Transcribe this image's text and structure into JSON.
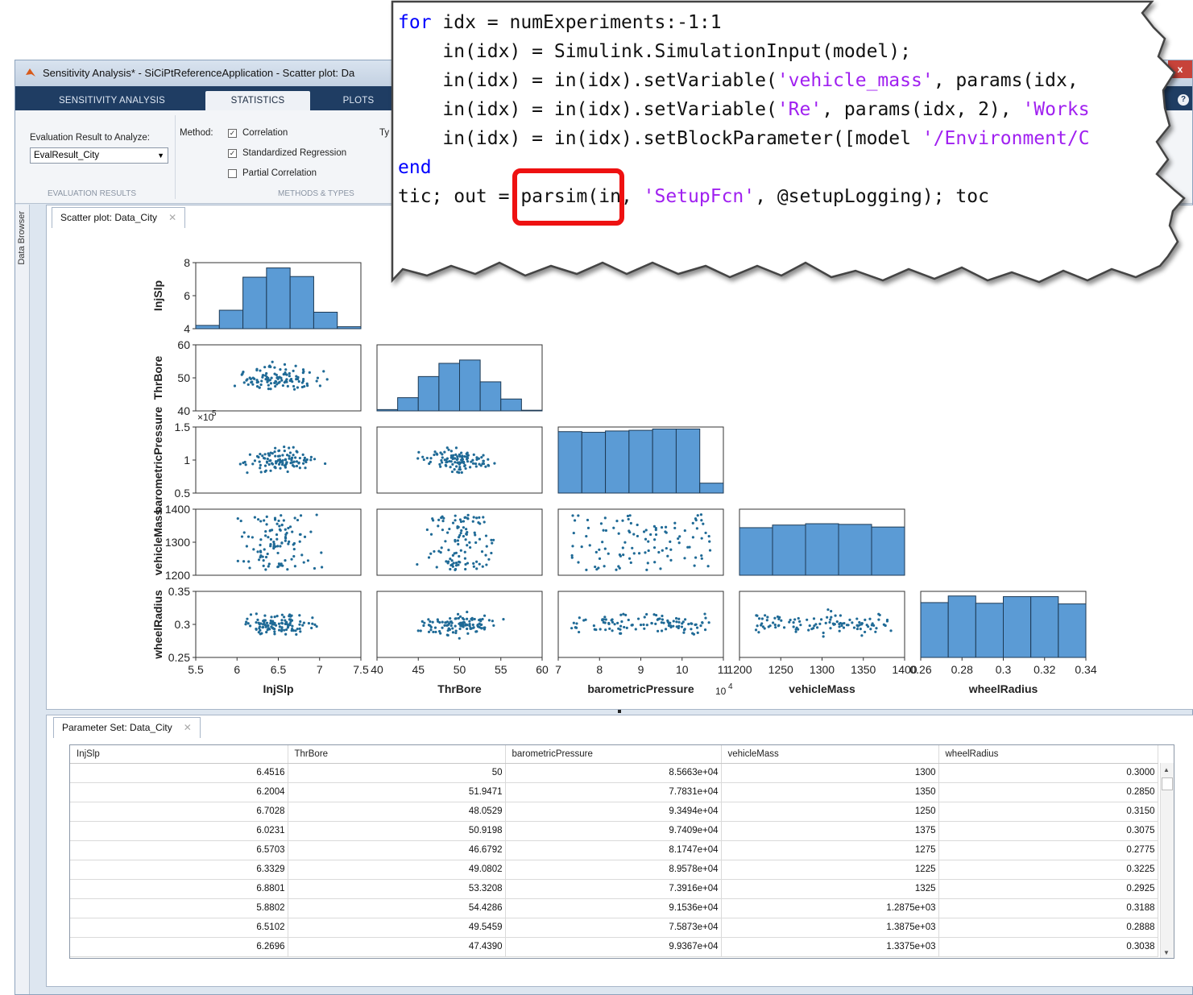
{
  "window": {
    "title": "Sensitivity Analysis* - SiCiPtReferenceApplication - Scatter plot: Da",
    "close_label": "x"
  },
  "ribbon": {
    "tabs": [
      "SENSITIVITY ANALYSIS",
      "STATISTICS",
      "PLOTS"
    ],
    "active_tab": "STATISTICS",
    "help_label": "?",
    "eval_label": "Evaluation Result to Analyze:",
    "eval_value": "EvalResult_City",
    "method_label": "Method:",
    "methods": [
      {
        "label": "Correlation",
        "checked": true
      },
      {
        "label": "Standardized Regression",
        "checked": true
      },
      {
        "label": "Partial Correlation",
        "checked": false
      }
    ],
    "type_label": "Ty",
    "group_eval": "EVALUATION RESULTS",
    "group_methods": "METHODS & TYPES"
  },
  "sidebar": {
    "label": "Data Browser"
  },
  "plot_doc": {
    "tab": "Scatter plot: Data_City",
    "close": "✕"
  },
  "table_doc": {
    "tab": "Parameter Set: Data_City",
    "close": "✕"
  },
  "chart_data": {
    "type": "scatter",
    "variables": [
      "InjSlp",
      "ThrBore",
      "barometricPressure",
      "vehicleMass",
      "wheelRadius"
    ],
    "axes": [
      {
        "name": "InjSlp",
        "range": [
          5.5,
          7.5
        ],
        "ticks": [
          "5.5",
          "6",
          "6.5",
          "7",
          "7.5"
        ],
        "y_ticks": [
          "4",
          "6",
          "8"
        ]
      },
      {
        "name": "ThrBore",
        "range": [
          40,
          60
        ],
        "ticks": [
          "40",
          "45",
          "50",
          "55",
          "60"
        ],
        "y_ticks": [
          "40",
          "50",
          "60"
        ]
      },
      {
        "name": "barometricPressure",
        "range": [
          0.5,
          1.5
        ],
        "ticks": [
          "7",
          "8",
          "9",
          "10",
          "11"
        ],
        "y_ticks": [
          "0.5",
          "1",
          "1.5"
        ],
        "x_multiplier": "10",
        "x_exponent": "4",
        "y_multiplier": "×10",
        "y_exponent": "5"
      },
      {
        "name": "vehicleMass",
        "range": [
          1200,
          1400
        ],
        "ticks": [
          "1200",
          "1250",
          "1300",
          "1350",
          "1400"
        ],
        "y_ticks": [
          "1200",
          "1300",
          "1400"
        ]
      },
      {
        "name": "wheelRadius",
        "range": [
          0.25,
          0.35
        ],
        "ticks": [
          "0.26",
          "0.28",
          "0.3",
          "0.32",
          "0.34"
        ],
        "y_ticks": [
          "0.25",
          "0.3",
          "0.35"
        ]
      }
    ],
    "histograms": [
      [
        0.05,
        0.28,
        0.78,
        0.92,
        0.79,
        0.25,
        0.03
      ],
      [
        0.02,
        0.2,
        0.52,
        0.72,
        0.77,
        0.44,
        0.18,
        0.01
      ],
      [
        0.93,
        0.92,
        0.94,
        0.95,
        0.97,
        0.97,
        0.15
      ],
      [
        0.72,
        0.76,
        0.78,
        0.77,
        0.73
      ],
      [
        0.83,
        0.93,
        0.82,
        0.92,
        0.92,
        0.81
      ]
    ],
    "grid": false,
    "legend": "none"
  },
  "table": {
    "columns": [
      "InjSlp",
      "ThrBore",
      "barometricPressure",
      "vehicleMass",
      "wheelRadius"
    ],
    "rows": [
      [
        "6.4516",
        "50",
        "8.5663e+04",
        "1300",
        "0.3000"
      ],
      [
        "6.2004",
        "51.9471",
        "7.7831e+04",
        "1350",
        "0.2850"
      ],
      [
        "6.7028",
        "48.0529",
        "9.3494e+04",
        "1250",
        "0.3150"
      ],
      [
        "6.0231",
        "50.9198",
        "9.7409e+04",
        "1375",
        "0.3075"
      ],
      [
        "6.5703",
        "46.6792",
        "8.1747e+04",
        "1275",
        "0.2775"
      ],
      [
        "6.3329",
        "49.0802",
        "8.9578e+04",
        "1225",
        "0.3225"
      ],
      [
        "6.8801",
        "53.3208",
        "7.3916e+04",
        "1325",
        "0.2925"
      ],
      [
        "5.8802",
        "54.4286",
        "9.1536e+04",
        "1.2875e+03",
        "0.3188"
      ],
      [
        "6.5102",
        "49.5459",
        "7.5873e+04",
        "1.3875e+03",
        "0.2888"
      ],
      [
        "6.2696",
        "47.4390",
        "9.9367e+04",
        "1.3375e+03",
        "0.3038"
      ]
    ]
  },
  "code": {
    "lines": [
      [
        {
          "t": "for",
          "c": "kw"
        },
        {
          "t": " idx = numExperiments:-1:1"
        }
      ],
      [
        {
          "t": "    in(idx) = Simulink.SimulationInput(model);"
        }
      ],
      [
        {
          "t": "    in(idx) = in(idx).setVariable("
        },
        {
          "t": "'vehicle_mass'",
          "c": "str"
        },
        {
          "t": ", params(idx,"
        }
      ],
      [
        {
          "t": "    in(idx) = in(idx).setVariable("
        },
        {
          "t": "'Re'",
          "c": "str"
        },
        {
          "t": ", params(idx, 2), "
        },
        {
          "t": "'Works",
          "c": "str"
        }
      ],
      [
        {
          "t": "    in(idx) = in(idx).setBlockParameter([model "
        },
        {
          "t": "'/Environment/C",
          "c": "str"
        }
      ],
      [
        {
          "t": "end",
          "c": "kw"
        }
      ],
      [
        {
          "t": "tic; out = parsim(in, "
        },
        {
          "t": "'SetupFcn'",
          "c": "str"
        },
        {
          "t": ", @setupLogging); toc"
        }
      ]
    ]
  },
  "colors": {
    "bar_fill": "#5b9bd5",
    "point": "#1f6a96",
    "ribbon_bg": "#1f3d63",
    "highlight": "#ee1111",
    "keyword": "#0000ff",
    "string": "#a020f0"
  }
}
